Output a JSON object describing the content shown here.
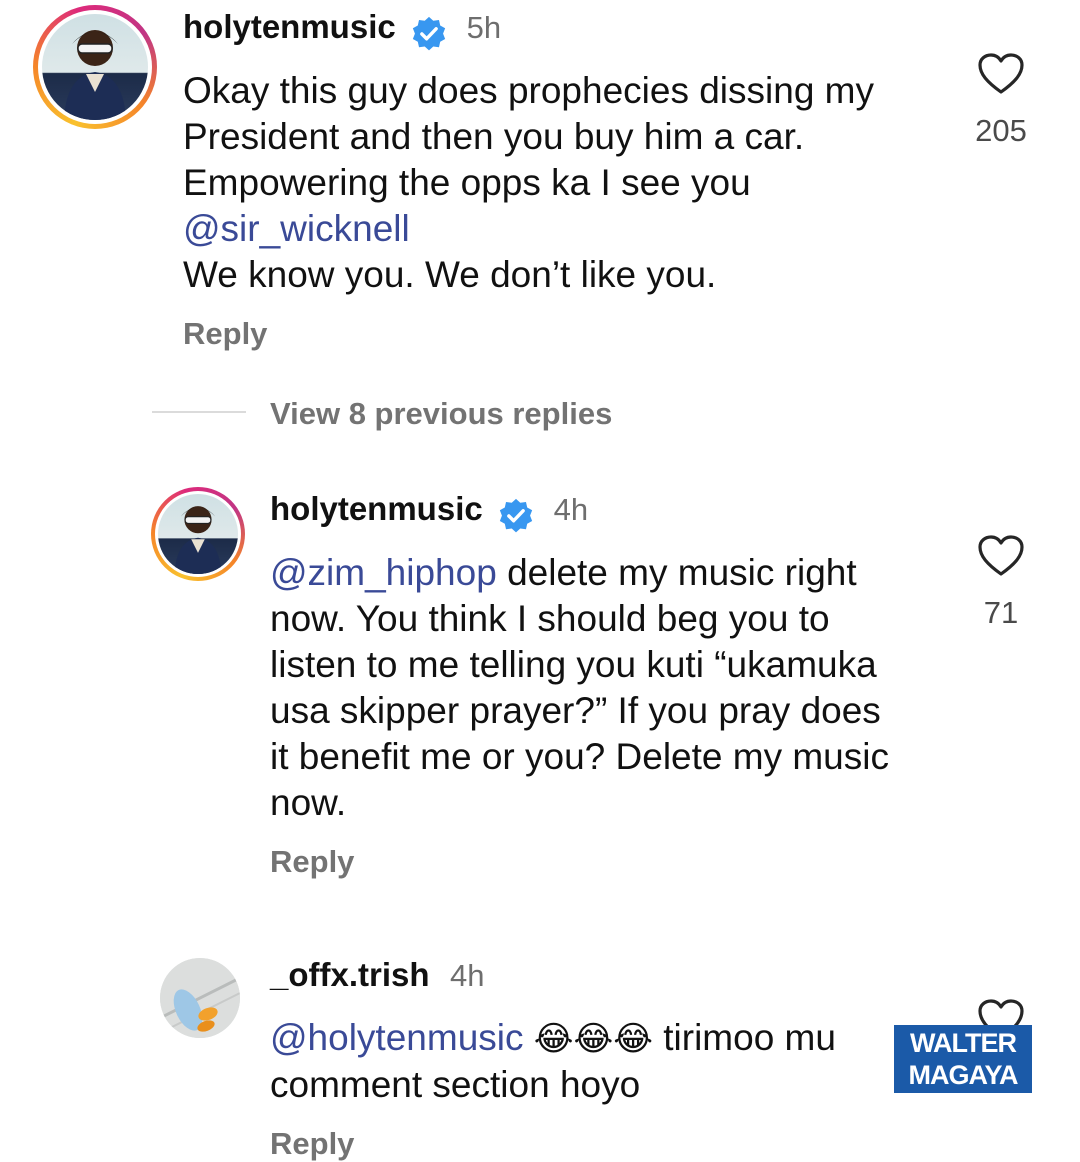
{
  "comments": [
    {
      "username": "holytenmusic",
      "time": "5h",
      "lines": [
        "Okay this guy does prophecies dissing my",
        "President and then you buy him a car.",
        "Empowering the opps ka I see you"
      ],
      "mention_line": "@sir_wicknell",
      "last_line": "We know you. We don’t like you.",
      "likes": "205",
      "reply_label": "Reply"
    },
    {
      "username": "holytenmusic",
      "time": "4h",
      "mention": "@zim_hiphop",
      "first_line_rest": " delete my music right",
      "lines": [
        "now. You think I should beg you to",
        "listen to me telling you kuti “ukamuka",
        "usa skipper prayer?” If you pray does",
        "it benefit me or you? Delete my music",
        "now."
      ],
      "likes": "71",
      "reply_label": "Reply"
    },
    {
      "username": "_offx.trish",
      "time": "4h",
      "mention": "@holytenmusic",
      "emojis": "😂😂😂",
      "first_line_rest": " tirimoo mu",
      "second_line": "comment section hoyo",
      "reply_label": "Reply"
    }
  ],
  "view_previous": "View 8 previous replies",
  "watermark": {
    "line1": "WALTER",
    "line2": "MAGAYA"
  },
  "colors": {
    "mention": "#3a4a97",
    "verified": "#3897f0",
    "watermark_bg": "#1b5aa8"
  }
}
